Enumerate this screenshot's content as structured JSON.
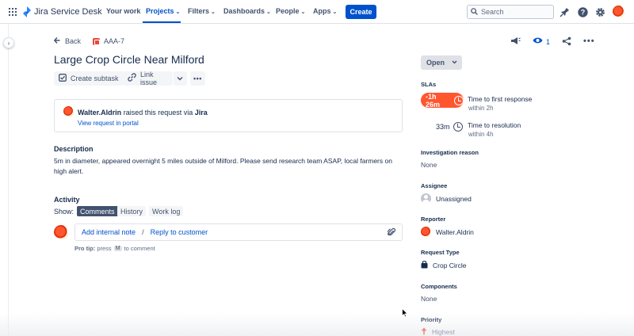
{
  "nav": {
    "product": "Jira Service Desk",
    "items": [
      {
        "label": "Your work",
        "has_dropdown": false
      },
      {
        "label": "Projects",
        "has_dropdown": true,
        "active": true
      },
      {
        "label": "Filters",
        "has_dropdown": true
      },
      {
        "label": "Dashboards",
        "has_dropdown": true
      },
      {
        "label": "People",
        "has_dropdown": true
      },
      {
        "label": "Apps",
        "has_dropdown": true
      }
    ],
    "create_label": "Create",
    "search_placeholder": "Search",
    "icons": [
      "notifications-icon",
      "help-icon",
      "settings-icon",
      "profile-avatar"
    ]
  },
  "breadcrumb": {
    "back_label": "Back",
    "issue_key": "AAA-7"
  },
  "issue": {
    "title": "Large Crop Circle Near Milford",
    "actions": [
      "Create subtask",
      "Link issue"
    ],
    "watchers_count": "1"
  },
  "request": {
    "reporter_name": "Walter.Aldrin",
    "raised_text": "raised this request via",
    "channel": "Jira",
    "portal_link": "View request in portal"
  },
  "description": {
    "heading": "Description",
    "text": "5m in diameter, appeared overnight 5 miles outside of Milford. Please send research team ASAP, local farmers on high alert."
  },
  "activity": {
    "heading": "Activity",
    "show_label": "Show:",
    "tabs": [
      {
        "label": "Comments",
        "active": true
      },
      {
        "label": "History",
        "active": false
      },
      {
        "label": "Work log",
        "active": false
      }
    ],
    "add_internal_note": "Add internal note",
    "separator": "/",
    "reply_to_customer": "Reply to customer",
    "protip_prefix": "Pro tip:",
    "protip_press": "press",
    "protip_key": "M",
    "protip_suffix": "to comment"
  },
  "sidebar": {
    "status": "Open",
    "slas_label": "SLAs",
    "slas": [
      {
        "time": "-1h 26m",
        "name": "Time to first response",
        "target": "within 2h",
        "breached": true,
        "color": "#ff5630"
      },
      {
        "time": "33m",
        "name": "Time to resolution",
        "target": "within 4h",
        "breached": false
      }
    ],
    "fields": {
      "investigation_reason": {
        "label": "Investigation reason",
        "value": "None"
      },
      "assignee": {
        "label": "Assignee",
        "value": "Unassigned"
      },
      "reporter": {
        "label": "Reporter",
        "value": "Walter.Aldrin"
      },
      "request_type": {
        "label": "Request Type",
        "value": "Crop Circle"
      },
      "components": {
        "label": "Components",
        "value": "None"
      },
      "priority": {
        "label": "Priority",
        "value": "Highest",
        "color": "#de350b"
      }
    }
  },
  "colors": {
    "brand": "#0052cc",
    "text": "#172b4d",
    "subtle": "#42526e",
    "danger": "#ff5630"
  }
}
